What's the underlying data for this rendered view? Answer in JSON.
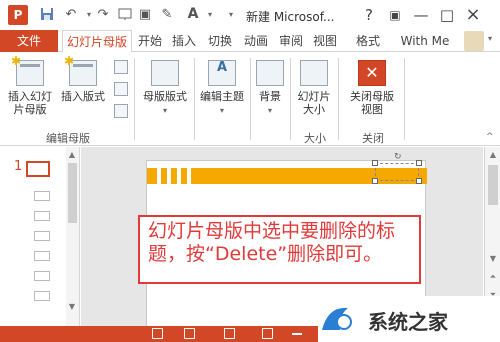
{
  "window": {
    "title": "新建 Microsof...",
    "help": "?",
    "ribbon_toggle": "▣",
    "minimize": "—",
    "restore": "□",
    "close": "×",
    "app_logo": "P"
  },
  "tabs": {
    "file": "文件",
    "slide_master": "幻灯片母版",
    "home": "开始",
    "insert": "插入",
    "transitions": "切换",
    "animations": "动画",
    "review": "审阅",
    "view": "视图",
    "format": "格式",
    "user": "With Me"
  },
  "ribbon": {
    "insert_slide_master": "插入幻灯片母版",
    "insert_layout": "插入版式",
    "master_layout": "母版版式",
    "edit_theme": "编辑主题",
    "background": "背景",
    "slide_size": "幻灯片大小",
    "close_master_view": "关闭母版视图",
    "group_edit_master": "编辑母版",
    "group_size": "大小",
    "group_close": "关闭"
  },
  "thumbs": {
    "slide_number": "1"
  },
  "annotation": {
    "text": "幻灯片母版中选中要删除的标题，按“Delete”删除即可。"
  },
  "watermark": {
    "text": "系统之家"
  },
  "colors": {
    "accent": "#d24726",
    "slide_band": "#f5a800",
    "annotation": "#e03a3a"
  }
}
